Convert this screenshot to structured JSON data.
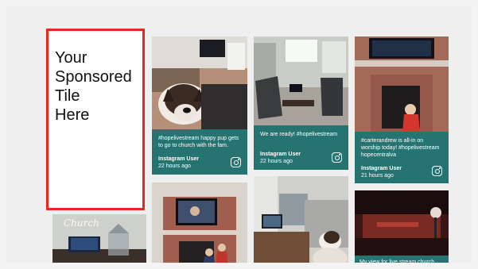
{
  "sponsor": {
    "text": "Your\nSponsored\nTile\nHere"
  },
  "posts": [
    {
      "caption": "#hopelivestream happy pup gets to go to church with the fam.",
      "user": "Instagram User",
      "time": "22 hours ago",
      "icon": "instagram-icon"
    },
    {
      "caption": "We are ready! #hopelivestream",
      "user": "Instagram User",
      "time": "22 hours ago",
      "icon": "instagram-icon"
    },
    {
      "caption": "#carterandrew is all-in on worship today! #hopelivestream hopecentralva",
      "user": "Instagram User",
      "time": "21 hours ago",
      "icon": "instagram-icon"
    },
    {
      "caption": "My view for live stream church today"
    }
  ],
  "lower_left_photo_text": "Church",
  "colors": {
    "caption_bg": "#267472",
    "sponsor_border": "#e8271f",
    "accent_yellow": "#f1b419"
  }
}
